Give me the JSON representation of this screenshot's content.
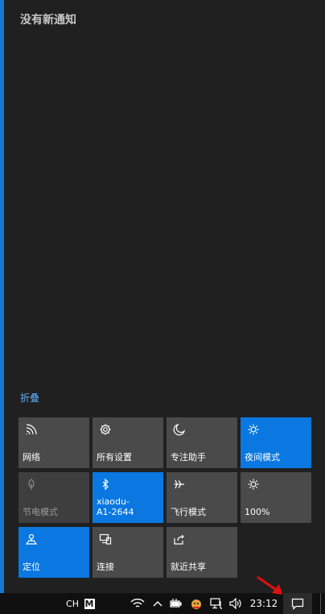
{
  "panel": {
    "title": "没有新通知",
    "collapse_label": "折叠"
  },
  "tiles": [
    {
      "label": "网络",
      "icon": "network-icon",
      "state": "off-available"
    },
    {
      "label": "所有设置",
      "icon": "settings-gear-icon",
      "state": "off-available"
    },
    {
      "label": "专注助手",
      "icon": "moon-icon",
      "state": "off-available"
    },
    {
      "label": "夜间模式",
      "icon": "night-light-sun-icon",
      "state": "on"
    },
    {
      "label": "节电模式",
      "icon": "battery-saver-leaf-icon",
      "state": "disabled"
    },
    {
      "label": "xiaodu-\nA1-2644",
      "icon": "bluetooth-icon",
      "state": "on"
    },
    {
      "label": "飞行模式",
      "icon": "airplane-icon",
      "state": "off-available"
    },
    {
      "label": "100%",
      "icon": "brightness-sun-icon",
      "state": "off-available"
    },
    {
      "label": "定位",
      "icon": "location-icon",
      "state": "on"
    },
    {
      "label": "连接",
      "icon": "connect-icon",
      "state": "off-available"
    },
    {
      "label": "就近共享",
      "icon": "nearby-share-icon",
      "state": "off-available"
    }
  ],
  "taskbar": {
    "input_lang": "CH",
    "ime_glyph": "M",
    "time": "23:12"
  },
  "colors": {
    "accent": "#0a78e0",
    "tile": "#4a4a4a",
    "link": "#5fb0ff",
    "annotation_arrow": "#e01010"
  }
}
